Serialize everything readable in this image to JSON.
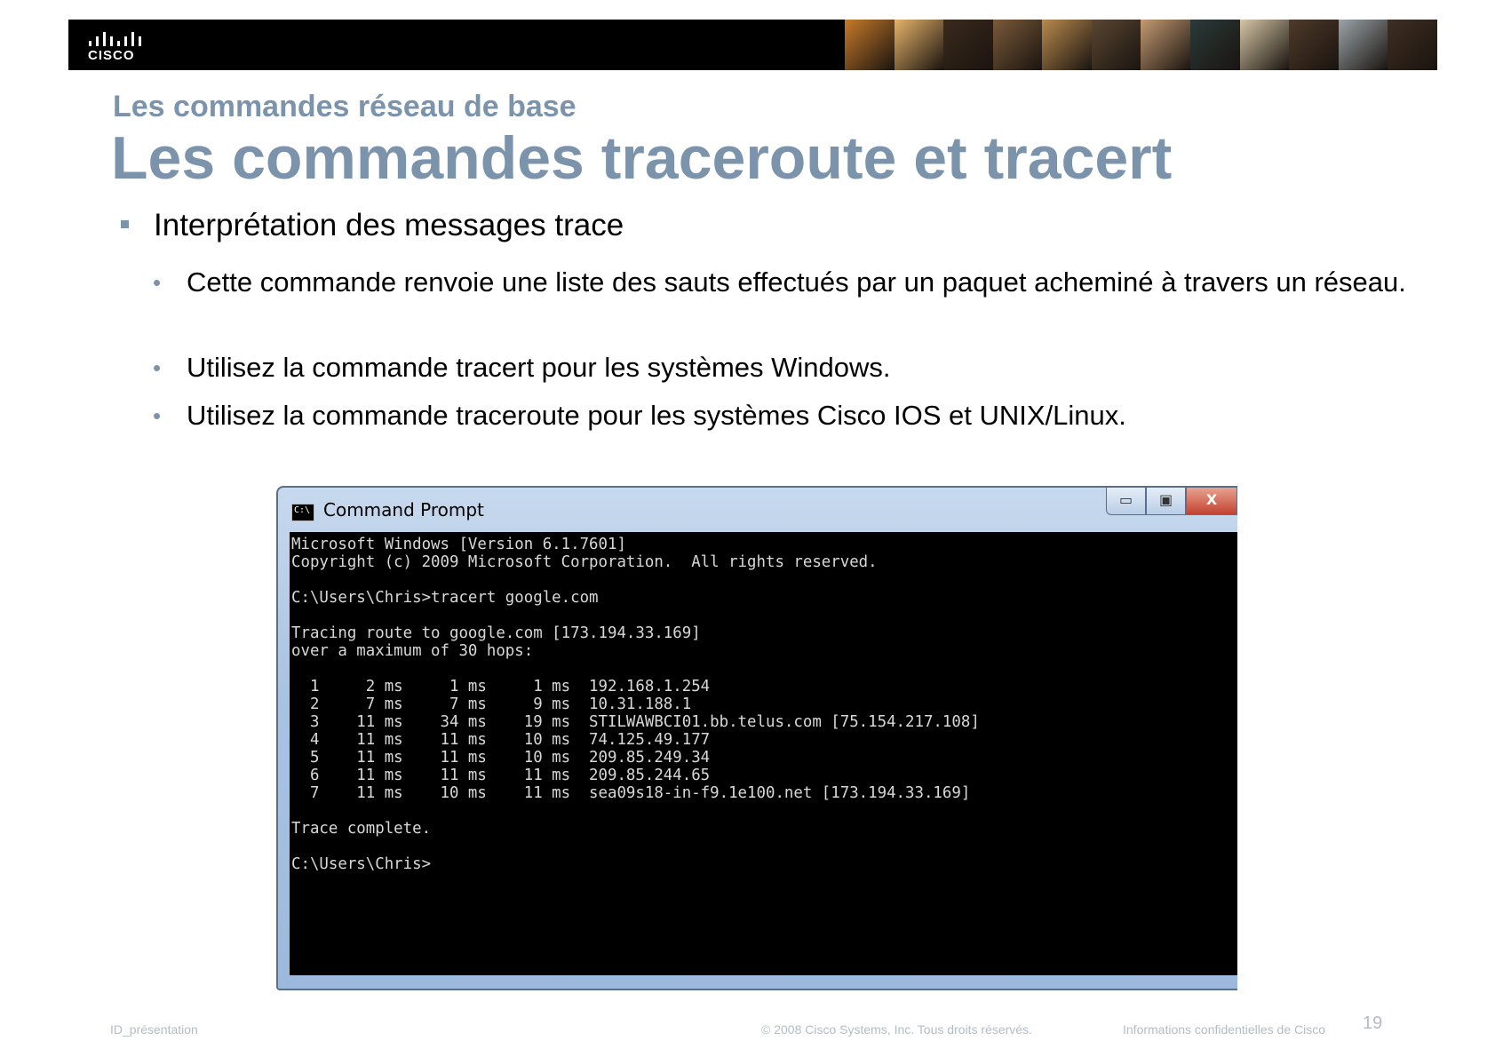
{
  "header": {
    "logo_text": "CISCO",
    "photo_strip_colors": [
      "#c77a2a",
      "#e6b36b",
      "#3a2a1c",
      "#7a5a3a",
      "#b88a4e",
      "#5a4632",
      "#c49a72",
      "#2a3a3a",
      "#d6c6a6",
      "#4e3a2a",
      "#9aa4a8",
      "#3e2e22"
    ]
  },
  "slide": {
    "subtitle": "Les commandes réseau de base",
    "title": "Les commandes traceroute et tracert",
    "bullet_l1": "Interprétation des messages trace",
    "bullets_l2": [
      "Cette commande renvoie une liste des sauts effectués par un paquet acheminé à travers un réseau.",
      "Utilisez la commande tracert pour les systèmes Windows.",
      "Utilisez la commande traceroute pour les systèmes Cisco IOS et UNIX/Linux."
    ]
  },
  "cmd": {
    "title": "Command Prompt",
    "icon_glyph": "C:\\",
    "minimize_glyph": "▭",
    "maximize_glyph": "▣",
    "close_glyph": "X",
    "lines": [
      "Microsoft Windows [Version 6.1.7601]",
      "Copyright (c) 2009 Microsoft Corporation.  All rights reserved.",
      "",
      "C:\\Users\\Chris>tracert google.com",
      "",
      "Tracing route to google.com [173.194.33.169]",
      "over a maximum of 30 hops:",
      "",
      "  1     2 ms     1 ms     1 ms  192.168.1.254",
      "  2     7 ms     7 ms     9 ms  10.31.188.1",
      "  3    11 ms    34 ms    19 ms  STILWAWBCI01.bb.telus.com [75.154.217.108]",
      "  4    11 ms    11 ms    10 ms  74.125.49.177",
      "  5    11 ms    11 ms    10 ms  209.85.249.34",
      "  6    11 ms    11 ms    11 ms  209.85.244.65",
      "  7    11 ms    10 ms    11 ms  sea09s18-in-f9.1e100.net [173.194.33.169]",
      "",
      "Trace complete.",
      "",
      "C:\\Users\\Chris>"
    ]
  },
  "footer": {
    "left": "ID_présentation",
    "center": "© 2008 Cisco Systems, Inc. Tous droits réservés.",
    "right": "Informations confidentielles de Cisco",
    "page_number": "19"
  }
}
